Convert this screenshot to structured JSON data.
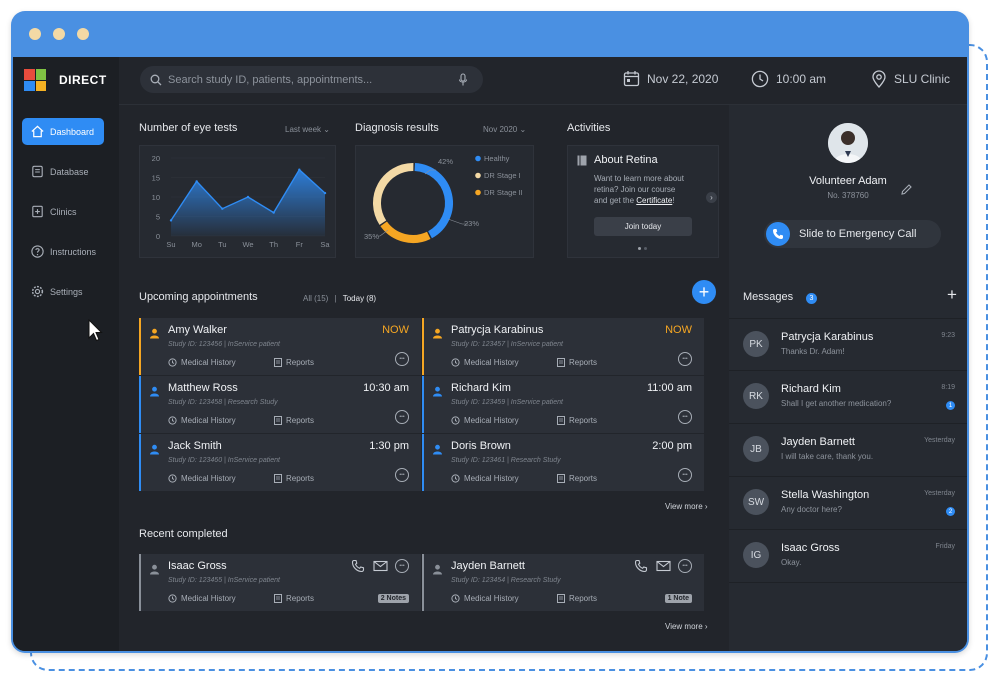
{
  "brand": {
    "name": "DIRECT"
  },
  "sidebar": {
    "items": [
      {
        "label": "Dashboard",
        "icon": "home-icon",
        "active": true
      },
      {
        "label": "Database",
        "icon": "database-icon"
      },
      {
        "label": "Clinics",
        "icon": "clinics-icon"
      },
      {
        "label": "Instructions",
        "icon": "help-icon"
      },
      {
        "label": "Settings",
        "icon": "gear-icon"
      }
    ]
  },
  "header": {
    "search_placeholder": "Search study ID, patients, appointments...",
    "date": "Nov 22, 2020",
    "time": "10:00 am",
    "location": "SLU Clinic"
  },
  "eye_tests": {
    "title": "Number of eye tests",
    "filter": "Last week",
    "chart_data": {
      "type": "area",
      "categories": [
        "Su",
        "Mo",
        "Tu",
        "We",
        "Th",
        "Fr",
        "Sa"
      ],
      "values": [
        4,
        14,
        7,
        10,
        6,
        17,
        11
      ],
      "yticks": [
        0,
        5,
        10,
        15,
        20
      ],
      "ylim": [
        0,
        20
      ],
      "color": "#2f8cf4"
    }
  },
  "diagnosis": {
    "title": "Diagnosis results",
    "filter": "Nov 2020",
    "chart_data": {
      "type": "pie",
      "labels": [
        "Healthy",
        "DR Stage I",
        "DR Stage II"
      ],
      "values": [
        42,
        35,
        23
      ],
      "value_labels": [
        "42%",
        "35%",
        "23%"
      ],
      "colors": [
        "#2f8cf4",
        "#f3d9a5",
        "#f5a623"
      ]
    }
  },
  "activities": {
    "title": "Activities",
    "card_title": "About Retina",
    "card_text_1": "Want to learn more about",
    "card_text_2": "retina? Join our course",
    "card_text_3": "and get the",
    "card_link": "Certificate",
    "card_text_end": "!",
    "button": "Join today"
  },
  "upcoming": {
    "title": "Upcoming appointments",
    "all_label": "All (15)",
    "separator": "|",
    "today_label": "Today (8)",
    "view_more": "View more",
    "medical_label": "Medical History",
    "reports_label": "Reports",
    "items": [
      {
        "name": "Amy Walker",
        "time": "NOW",
        "sub": "Study ID: 123456 | InService patient",
        "color": "#f5a623"
      },
      {
        "name": "Patrycja Karabinus",
        "time": "NOW",
        "sub": "Study ID: 123457 | InService patient",
        "color": "#f5a623"
      },
      {
        "name": "Matthew Ross",
        "time": "10:30 am",
        "sub": "Study ID: 123458 | Research Study",
        "color": "#2f8cf4"
      },
      {
        "name": "Richard Kim",
        "time": "11:00 am",
        "sub": "Study ID: 123459 | InService patient",
        "color": "#2f8cf4"
      },
      {
        "name": "Jack Smith",
        "time": "1:30 pm",
        "sub": "Study ID: 123460 | InService patient",
        "color": "#2f8cf4"
      },
      {
        "name": "Doris Brown",
        "time": "2:00 pm",
        "sub": "Study ID: 123461 | Research Study",
        "color": "#2f8cf4"
      }
    ]
  },
  "recent": {
    "title": "Recent completed",
    "view_more": "View more",
    "medical_label": "Medical History",
    "reports_label": "Reports",
    "items": [
      {
        "name": "Isaac Gross",
        "sub": "Study ID: 123455 | InService patient",
        "notes": "2 Notes"
      },
      {
        "name": "Jayden Barnett",
        "sub": "Study ID: 123454 | Research Study",
        "notes": "1 Note"
      }
    ]
  },
  "profile": {
    "name": "Volunteer Adam",
    "number": "No. 378760",
    "emergency": "Slide to Emergency Call"
  },
  "messages": {
    "title": "Messages",
    "count": "3",
    "items": [
      {
        "initials": "PK",
        "name": "Patrycja Karabinus",
        "text": "Thanks Dr. Adam!",
        "time": "9:23",
        "badge": ""
      },
      {
        "initials": "RK",
        "name": "Richard Kim",
        "text": "Shall I get another medication?",
        "time": "8:19",
        "badge": "1"
      },
      {
        "initials": "JB",
        "name": "Jayden Barnett",
        "text": "I will take care, thank you.",
        "time": "Yesterday",
        "badge": ""
      },
      {
        "initials": "SW",
        "name": "Stella Washington",
        "text": "Any doctor here?",
        "time": "Yesterday",
        "badge": "2"
      },
      {
        "initials": "IG",
        "name": "Isaac Gross",
        "text": "Okay.",
        "time": "Friday",
        "badge": ""
      }
    ]
  }
}
